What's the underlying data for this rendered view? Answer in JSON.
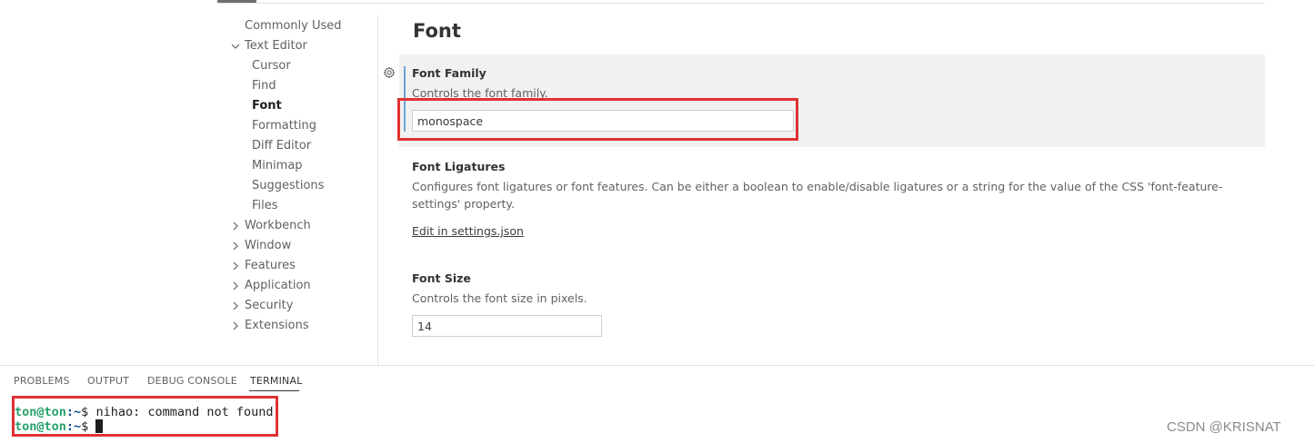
{
  "toc": {
    "items": [
      {
        "label": "Commonly Used",
        "kind": "top",
        "chevron": ""
      },
      {
        "label": "Text Editor",
        "kind": "top",
        "chevron": "expanded"
      },
      {
        "label": "Cursor",
        "kind": "child",
        "chevron": ""
      },
      {
        "label": "Find",
        "kind": "child",
        "chevron": ""
      },
      {
        "label": "Font",
        "kind": "child",
        "chevron": "",
        "active": true
      },
      {
        "label": "Formatting",
        "kind": "child",
        "chevron": ""
      },
      {
        "label": "Diff Editor",
        "kind": "child",
        "chevron": ""
      },
      {
        "label": "Minimap",
        "kind": "child",
        "chevron": ""
      },
      {
        "label": "Suggestions",
        "kind": "child",
        "chevron": ""
      },
      {
        "label": "Files",
        "kind": "child",
        "chevron": ""
      },
      {
        "label": "Workbench",
        "kind": "top",
        "chevron": "collapsed"
      },
      {
        "label": "Window",
        "kind": "top",
        "chevron": "collapsed"
      },
      {
        "label": "Features",
        "kind": "top",
        "chevron": "collapsed"
      },
      {
        "label": "Application",
        "kind": "top",
        "chevron": "collapsed"
      },
      {
        "label": "Security",
        "kind": "top",
        "chevron": "collapsed"
      },
      {
        "label": "Extensions",
        "kind": "top",
        "chevron": "collapsed"
      }
    ]
  },
  "settings": {
    "section_title": "Font",
    "font_family": {
      "title": "Font Family",
      "description": "Controls the font family.",
      "value": "monospace"
    },
    "font_ligatures": {
      "title": "Font Ligatures",
      "description": "Configures font ligatures or font features. Can be either a boolean to enable/disable ligatures or a string for the value of the CSS 'font-feature-settings' property.",
      "link": "Edit in settings.json"
    },
    "font_size": {
      "title": "Font Size",
      "description": "Controls the font size in pixels.",
      "value": "14"
    }
  },
  "panel": {
    "tabs": [
      {
        "label": "PROBLEMS",
        "active": false
      },
      {
        "label": "OUTPUT",
        "active": false
      },
      {
        "label": "DEBUG CONSOLE",
        "active": false
      },
      {
        "label": "TERMINAL",
        "active": true
      }
    ],
    "terminal": {
      "line1": {
        "userhost": "ton@ton",
        "path": ":~",
        "prompt": "$ ",
        "text": "nihao: command not found"
      },
      "line2": {
        "userhost": "ton@ton",
        "path": ":~",
        "prompt": "$ "
      }
    }
  },
  "watermark": "CSDN @KRISNAT",
  "colors": {
    "highlight": "#e03131",
    "focus_bar": "#6aa3d8",
    "terminal_user": "#26a269",
    "terminal_path": "#12488b"
  },
  "icons": [
    "chevron-right-icon",
    "chevron-down-icon",
    "gear-icon"
  ]
}
